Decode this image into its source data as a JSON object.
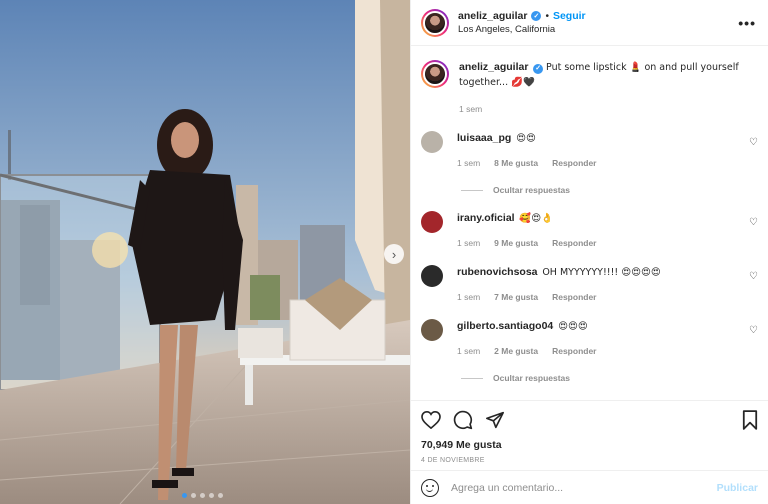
{
  "post": {
    "username": "aneliz_aguilar",
    "follow_label": "Seguir",
    "separator": "•",
    "location": "Los Angeles, California",
    "more_icon": "more-options-icon",
    "caption_text": "Put some lipstick 💄 on and pull yourself together... 💋🖤",
    "caption_time": "1 sem"
  },
  "comments": [
    {
      "username": "luisaaa_pg",
      "text": "😍😍",
      "time": "1 sem",
      "likes": "8 Me gusta",
      "reply": "Responder",
      "avatar_color": "#b9b2a8",
      "replies_label": "Ocultar respuestas"
    },
    {
      "username": "irany.oficial",
      "text": "🥰😍👌",
      "time": "1 sem",
      "likes": "9 Me gusta",
      "reply": "Responder",
      "avatar_color": "#a3262b"
    },
    {
      "username": "rubenovichsosa",
      "text": "OH MYYYYYY!!!! 😍😍😍😍",
      "time": "1 sem",
      "likes": "7 Me gusta",
      "reply": "Responder",
      "avatar_color": "#2a2a2a"
    },
    {
      "username": "gilberto.santiago04",
      "text": "😍😍😍",
      "time": "1 sem",
      "likes": "2 Me gusta",
      "reply": "Responder",
      "avatar_color": "#6b5a46",
      "replies_label": "Ocultar respuestas"
    }
  ],
  "actions": {
    "likes": "70,949 Me gusta",
    "date": "4 DE NOVIEMBRE"
  },
  "composer": {
    "placeholder": "Agrega un comentario...",
    "publish": "Publicar"
  },
  "colors": {
    "accent": "#0095f6",
    "verified": "#3897f0",
    "muted": "#8e8e8e"
  }
}
